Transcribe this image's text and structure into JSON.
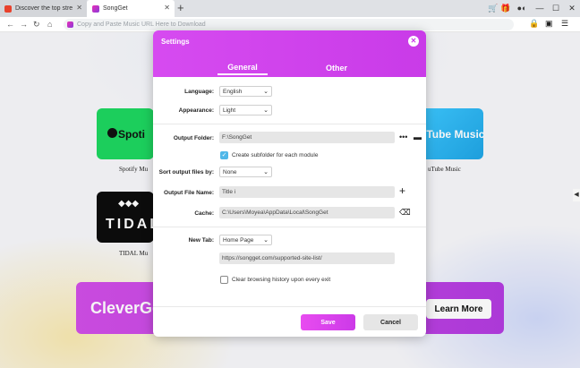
{
  "tabs": [
    {
      "label": "Discover the top stre"
    },
    {
      "label": "SongGet"
    }
  ],
  "new_tab_symbol": "+",
  "window_icons": {
    "cart": "cart-icon",
    "gift": "gift-icon",
    "theme": "theme-toggle-icon",
    "minimize": "—",
    "maximize": "☐",
    "close": "✕"
  },
  "address_bar": {
    "placeholder": "Copy and Paste Music URL Here to Download"
  },
  "page": {
    "cards": [
      {
        "name": "Spotify",
        "text": "Spoti",
        "label": "Spotify Mu"
      },
      {
        "name": "YouTube Music",
        "text": "uTube Music",
        "label": "uTube Music"
      },
      {
        "name": "TIDAL",
        "text": "TIDAL",
        "label": "TIDAL Mu"
      }
    ],
    "promo": {
      "brand": "CleverGe",
      "button": "Learn More"
    }
  },
  "settings": {
    "title": "Settings",
    "tabs": {
      "general": "General",
      "other": "Other"
    },
    "language": {
      "label": "Language:",
      "value": "English"
    },
    "appearance": {
      "label": "Appearance:",
      "value": "Light"
    },
    "output_folder": {
      "label": "Output Folder:",
      "value": "F:\\SongGet"
    },
    "create_subfolder": {
      "label": "Create subfolder for each module",
      "checked": true
    },
    "sort_output": {
      "label": "Sort output files by:",
      "value": "None"
    },
    "output_file_name": {
      "label": "Output File Name:",
      "value": "Title i"
    },
    "cache": {
      "label": "Cache:",
      "value": "C:\\Users\\Moyea\\AppData\\Local\\SongGet"
    },
    "new_tab": {
      "label": "New Tab:",
      "value": "Home Page",
      "url": "https://songget.com/supported-site-list/"
    },
    "clear_history": {
      "label": "Clear browsing history upon every exit",
      "checked": false
    },
    "save": "Save",
    "cancel": "Cancel"
  },
  "colors": {
    "accent": "#c93be8",
    "checkbox": "#4fb7e8"
  }
}
